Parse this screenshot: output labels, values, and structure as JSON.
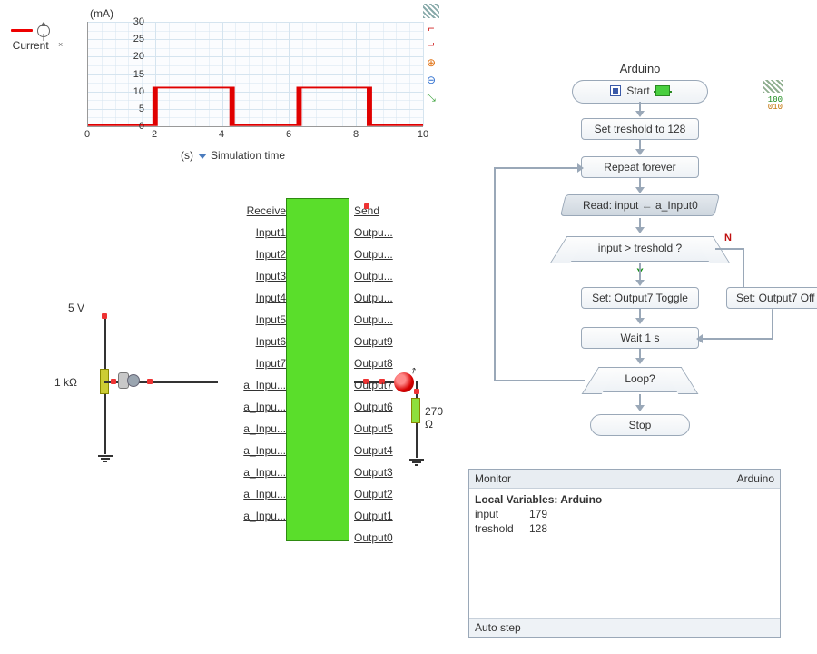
{
  "chart_data": {
    "type": "line",
    "title": "",
    "xlabel": "Simulation time",
    "xunit": "(s)",
    "ylabel": "",
    "yunit": "(mA)",
    "legend": "Current",
    "xlim": [
      0,
      10
    ],
    "ylim": [
      0,
      30
    ],
    "xticks": [
      0,
      2,
      4,
      6,
      8,
      10
    ],
    "yticks": [
      0,
      5,
      10,
      15,
      20,
      25,
      30
    ],
    "series": [
      {
        "name": "Current",
        "color": "#e00000",
        "x": [
          0,
          2,
          2,
          4.3,
          4.3,
          6.3,
          6.3,
          8.4,
          8.4,
          10
        ],
        "y": [
          0.2,
          0.2,
          11,
          11,
          0.2,
          0.2,
          11,
          11,
          0.2,
          0.2
        ]
      }
    ]
  },
  "circuit": {
    "v_source": "5 V",
    "r_input": "1 kΩ",
    "r_led": "270 Ω",
    "header_left": "Receive",
    "header_right": "Send",
    "pins_left": [
      "Input1",
      "Input2",
      "Input3",
      "Input4",
      "Input5",
      "Input6",
      "Input7",
      "a_Inpu...",
      "a_Inpu...",
      "a_Inpu...",
      "a_Inpu...",
      "a_Inpu...",
      "a_Inpu...",
      "a_Inpu..."
    ],
    "pins_right": [
      "Outpu...",
      "Outpu...",
      "Outpu...",
      "Outpu...",
      "Outpu...",
      "Output9",
      "Output8",
      "Output7",
      "Output6",
      "Output5",
      "Output4",
      "Output3",
      "Output2",
      "Output1",
      "Output0"
    ]
  },
  "flow": {
    "title": "Arduino",
    "start": "Start",
    "set_threshold": "Set  treshold  to  128",
    "repeat": "Repeat  forever",
    "read": "Read: input  ←  a_Input0",
    "cond": "input   > treshold    ?",
    "yes": "Y",
    "no": "N",
    "toggle": "Set: Output7 Toggle",
    "off": "Set: Output7 Off",
    "wait": "Wait  1 s",
    "loop": "Loop?",
    "stop": "Stop",
    "bin1": "100",
    "bin2": "010"
  },
  "monitor": {
    "hdr_left": "Monitor",
    "hdr_right": "Arduino",
    "section": "Local Variables: Arduino",
    "var1_name": "input",
    "var1_val": "179",
    "var2_name": "treshold",
    "var2_val": "128",
    "footer": "Auto step"
  }
}
